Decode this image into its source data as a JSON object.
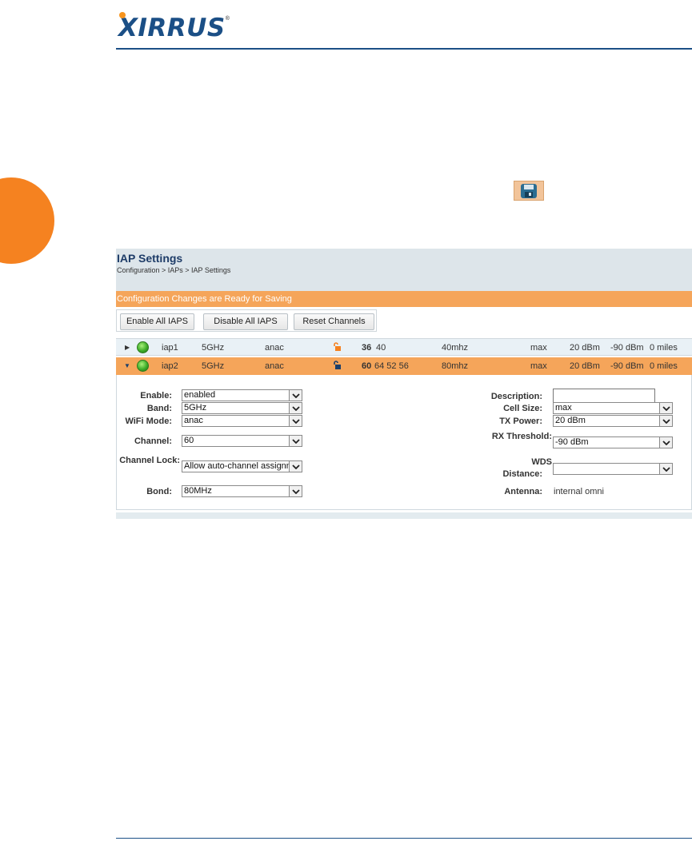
{
  "brand": {
    "logo_text": "XIRRUS",
    "reg_mark": "®"
  },
  "page": {
    "title": "IAP Settings",
    "breadcrumb": "Configuration > IAPs > IAP Settings",
    "notice": "Configuration Changes are Ready for Saving"
  },
  "toolbar": {
    "enable_all": "Enable All IAPS",
    "disable_all": "Disable All IAPS",
    "reset_channels": "Reset Channels"
  },
  "iaps": [
    {
      "name": "iap1",
      "band": "5GHz",
      "mode": "anac",
      "channel_primary": "36",
      "channel_rest": "40",
      "bond": "40mhz",
      "cell_size": "max",
      "tx_power": "20 dBm",
      "rx_threshold": "-90 dBm",
      "wds_distance": "0 miles",
      "status_icon": "green-led-icon",
      "lock_icon": "unlocked-icon"
    },
    {
      "name": "iap2",
      "band": "5GHz",
      "mode": "anac",
      "channel_primary": "60",
      "channel_rest": "64 52 56",
      "bond": "80mhz",
      "cell_size": "max",
      "tx_power": "20 dBm",
      "rx_threshold": "-90 dBm",
      "wds_distance": "0 miles",
      "status_icon": "green-led-icon",
      "lock_icon": "unlocked-icon"
    }
  ],
  "detail": {
    "labels": {
      "enable": "Enable:",
      "band": "Band:",
      "wifi_mode": "WiFi Mode:",
      "channel": "Channel:",
      "channel_lock": "Channel Lock:",
      "bond": "Bond:",
      "description": "Description:",
      "cell_size": "Cell Size:",
      "tx_power": "TX Power:",
      "rx_threshold": "RX Threshold:",
      "wds_distance_1": "WDS",
      "wds_distance_2": "Distance:",
      "antenna": "Antenna:"
    },
    "values": {
      "enable": "enabled",
      "band": "5GHz",
      "wifi_mode": "anac",
      "channel": "60",
      "channel_lock": "Allow auto-channel assignment",
      "bond": "80MHz",
      "description": "",
      "cell_size": "max",
      "tx_power": "20 dBm",
      "rx_threshold": "-90 dBm",
      "wds_distance": "",
      "antenna": "internal omni"
    }
  },
  "colors": {
    "brand_blue": "#1b4f86",
    "accent_orange": "#f58220",
    "notice_bar": "#f5a55a",
    "header_bg": "#dde5ea"
  },
  "icons": {
    "save": "floppy-disk-icon",
    "dropdown": "chevron-down-icon"
  }
}
